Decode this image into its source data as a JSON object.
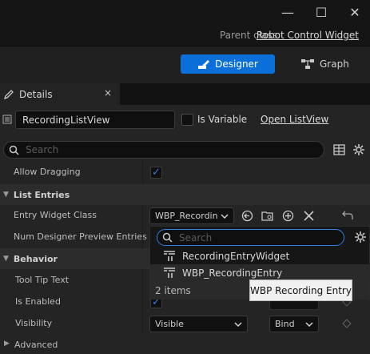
{
  "window": {
    "minimize": "—",
    "maximize": "☐",
    "close": "✕"
  },
  "parent_class": {
    "label": "Parent class:",
    "value": "Robot Control Widget"
  },
  "modes": {
    "designer": "Designer",
    "graph": "Graph"
  },
  "details_tab": {
    "label": "Details",
    "close": "×"
  },
  "widget": {
    "name": "RecordingListView",
    "is_variable_label": "Is Variable",
    "is_variable": false,
    "open_link": "Open ListView"
  },
  "search": {
    "placeholder": "Search"
  },
  "properties": {
    "allow_dragging": {
      "label": "Allow Dragging",
      "checked": true
    },
    "list_entries": {
      "category": "List Entries"
    },
    "entry_widget_class": {
      "label": "Entry Widget Class",
      "value": "WBP_Recordin"
    },
    "num_designer_preview": {
      "label": "Num Designer Preview Entries"
    },
    "behavior": {
      "category": "Behavior"
    },
    "tool_tip_text": {
      "label": "Tool Tip Text"
    },
    "is_enabled": {
      "label": "Is Enabled",
      "checked": true
    },
    "visibility": {
      "label": "Visibility",
      "value": "Visible",
      "bind": "Bind"
    },
    "advanced": {
      "category": "Advanced"
    }
  },
  "popup": {
    "search_placeholder": "Search",
    "items": [
      "RecordingEntryWidget",
      "WBP_RecordingEntry"
    ],
    "count": "2 items"
  },
  "tooltip": "WBP Recording Entry",
  "colors": {
    "accent": "#0a6fd8",
    "check": "#2f7fe6",
    "panel": "#242424"
  }
}
